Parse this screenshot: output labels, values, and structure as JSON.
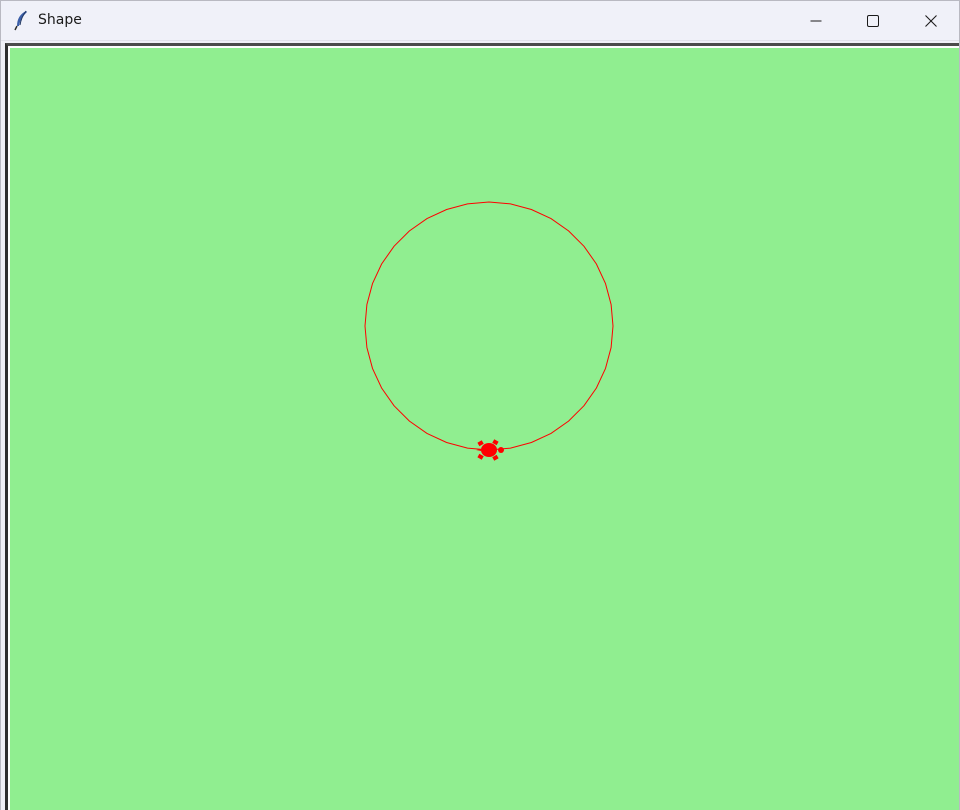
{
  "window": {
    "title": "Shape",
    "app_icon": "feather-icon",
    "controls": {
      "minimize": "minimize-icon",
      "maximize": "maximize-icon",
      "close": "close-icon"
    }
  },
  "canvas": {
    "background_color": "#90ee90",
    "pen_color": "#ff0000",
    "shape": "circle",
    "turtle_color": "#ff0000",
    "turtle_icon": "turtle-icon"
  }
}
